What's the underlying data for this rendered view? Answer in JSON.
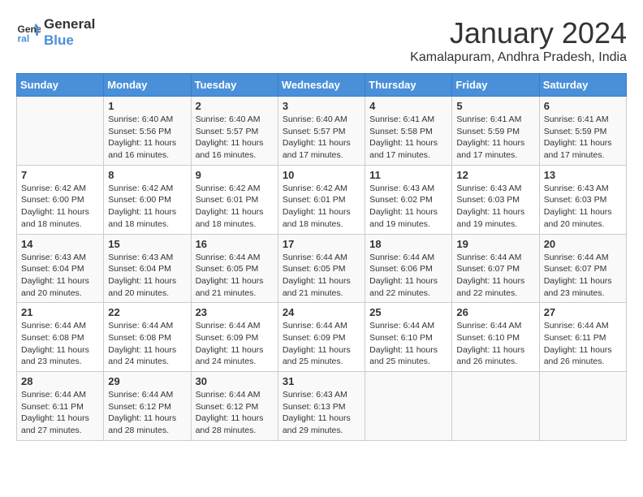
{
  "header": {
    "logo_line1": "General",
    "logo_line2": "Blue",
    "month_title": "January 2024",
    "subtitle": "Kamalapuram, Andhra Pradesh, India"
  },
  "days_of_week": [
    "Sunday",
    "Monday",
    "Tuesday",
    "Wednesday",
    "Thursday",
    "Friday",
    "Saturday"
  ],
  "weeks": [
    [
      {
        "num": "",
        "sunrise": "",
        "sunset": "",
        "daylight": ""
      },
      {
        "num": "1",
        "sunrise": "Sunrise: 6:40 AM",
        "sunset": "Sunset: 5:56 PM",
        "daylight": "Daylight: 11 hours and 16 minutes."
      },
      {
        "num": "2",
        "sunrise": "Sunrise: 6:40 AM",
        "sunset": "Sunset: 5:57 PM",
        "daylight": "Daylight: 11 hours and 16 minutes."
      },
      {
        "num": "3",
        "sunrise": "Sunrise: 6:40 AM",
        "sunset": "Sunset: 5:57 PM",
        "daylight": "Daylight: 11 hours and 17 minutes."
      },
      {
        "num": "4",
        "sunrise": "Sunrise: 6:41 AM",
        "sunset": "Sunset: 5:58 PM",
        "daylight": "Daylight: 11 hours and 17 minutes."
      },
      {
        "num": "5",
        "sunrise": "Sunrise: 6:41 AM",
        "sunset": "Sunset: 5:59 PM",
        "daylight": "Daylight: 11 hours and 17 minutes."
      },
      {
        "num": "6",
        "sunrise": "Sunrise: 6:41 AM",
        "sunset": "Sunset: 5:59 PM",
        "daylight": "Daylight: 11 hours and 17 minutes."
      }
    ],
    [
      {
        "num": "7",
        "sunrise": "Sunrise: 6:42 AM",
        "sunset": "Sunset: 6:00 PM",
        "daylight": "Daylight: 11 hours and 18 minutes."
      },
      {
        "num": "8",
        "sunrise": "Sunrise: 6:42 AM",
        "sunset": "Sunset: 6:00 PM",
        "daylight": "Daylight: 11 hours and 18 minutes."
      },
      {
        "num": "9",
        "sunrise": "Sunrise: 6:42 AM",
        "sunset": "Sunset: 6:01 PM",
        "daylight": "Daylight: 11 hours and 18 minutes."
      },
      {
        "num": "10",
        "sunrise": "Sunrise: 6:42 AM",
        "sunset": "Sunset: 6:01 PM",
        "daylight": "Daylight: 11 hours and 18 minutes."
      },
      {
        "num": "11",
        "sunrise": "Sunrise: 6:43 AM",
        "sunset": "Sunset: 6:02 PM",
        "daylight": "Daylight: 11 hours and 19 minutes."
      },
      {
        "num": "12",
        "sunrise": "Sunrise: 6:43 AM",
        "sunset": "Sunset: 6:03 PM",
        "daylight": "Daylight: 11 hours and 19 minutes."
      },
      {
        "num": "13",
        "sunrise": "Sunrise: 6:43 AM",
        "sunset": "Sunset: 6:03 PM",
        "daylight": "Daylight: 11 hours and 20 minutes."
      }
    ],
    [
      {
        "num": "14",
        "sunrise": "Sunrise: 6:43 AM",
        "sunset": "Sunset: 6:04 PM",
        "daylight": "Daylight: 11 hours and 20 minutes."
      },
      {
        "num": "15",
        "sunrise": "Sunrise: 6:43 AM",
        "sunset": "Sunset: 6:04 PM",
        "daylight": "Daylight: 11 hours and 20 minutes."
      },
      {
        "num": "16",
        "sunrise": "Sunrise: 6:44 AM",
        "sunset": "Sunset: 6:05 PM",
        "daylight": "Daylight: 11 hours and 21 minutes."
      },
      {
        "num": "17",
        "sunrise": "Sunrise: 6:44 AM",
        "sunset": "Sunset: 6:05 PM",
        "daylight": "Daylight: 11 hours and 21 minutes."
      },
      {
        "num": "18",
        "sunrise": "Sunrise: 6:44 AM",
        "sunset": "Sunset: 6:06 PM",
        "daylight": "Daylight: 11 hours and 22 minutes."
      },
      {
        "num": "19",
        "sunrise": "Sunrise: 6:44 AM",
        "sunset": "Sunset: 6:07 PM",
        "daylight": "Daylight: 11 hours and 22 minutes."
      },
      {
        "num": "20",
        "sunrise": "Sunrise: 6:44 AM",
        "sunset": "Sunset: 6:07 PM",
        "daylight": "Daylight: 11 hours and 23 minutes."
      }
    ],
    [
      {
        "num": "21",
        "sunrise": "Sunrise: 6:44 AM",
        "sunset": "Sunset: 6:08 PM",
        "daylight": "Daylight: 11 hours and 23 minutes."
      },
      {
        "num": "22",
        "sunrise": "Sunrise: 6:44 AM",
        "sunset": "Sunset: 6:08 PM",
        "daylight": "Daylight: 11 hours and 24 minutes."
      },
      {
        "num": "23",
        "sunrise": "Sunrise: 6:44 AM",
        "sunset": "Sunset: 6:09 PM",
        "daylight": "Daylight: 11 hours and 24 minutes."
      },
      {
        "num": "24",
        "sunrise": "Sunrise: 6:44 AM",
        "sunset": "Sunset: 6:09 PM",
        "daylight": "Daylight: 11 hours and 25 minutes."
      },
      {
        "num": "25",
        "sunrise": "Sunrise: 6:44 AM",
        "sunset": "Sunset: 6:10 PM",
        "daylight": "Daylight: 11 hours and 25 minutes."
      },
      {
        "num": "26",
        "sunrise": "Sunrise: 6:44 AM",
        "sunset": "Sunset: 6:10 PM",
        "daylight": "Daylight: 11 hours and 26 minutes."
      },
      {
        "num": "27",
        "sunrise": "Sunrise: 6:44 AM",
        "sunset": "Sunset: 6:11 PM",
        "daylight": "Daylight: 11 hours and 26 minutes."
      }
    ],
    [
      {
        "num": "28",
        "sunrise": "Sunrise: 6:44 AM",
        "sunset": "Sunset: 6:11 PM",
        "daylight": "Daylight: 11 hours and 27 minutes."
      },
      {
        "num": "29",
        "sunrise": "Sunrise: 6:44 AM",
        "sunset": "Sunset: 6:12 PM",
        "daylight": "Daylight: 11 hours and 28 minutes."
      },
      {
        "num": "30",
        "sunrise": "Sunrise: 6:44 AM",
        "sunset": "Sunset: 6:12 PM",
        "daylight": "Daylight: 11 hours and 28 minutes."
      },
      {
        "num": "31",
        "sunrise": "Sunrise: 6:43 AM",
        "sunset": "Sunset: 6:13 PM",
        "daylight": "Daylight: 11 hours and 29 minutes."
      },
      {
        "num": "",
        "sunrise": "",
        "sunset": "",
        "daylight": ""
      },
      {
        "num": "",
        "sunrise": "",
        "sunset": "",
        "daylight": ""
      },
      {
        "num": "",
        "sunrise": "",
        "sunset": "",
        "daylight": ""
      }
    ]
  ]
}
